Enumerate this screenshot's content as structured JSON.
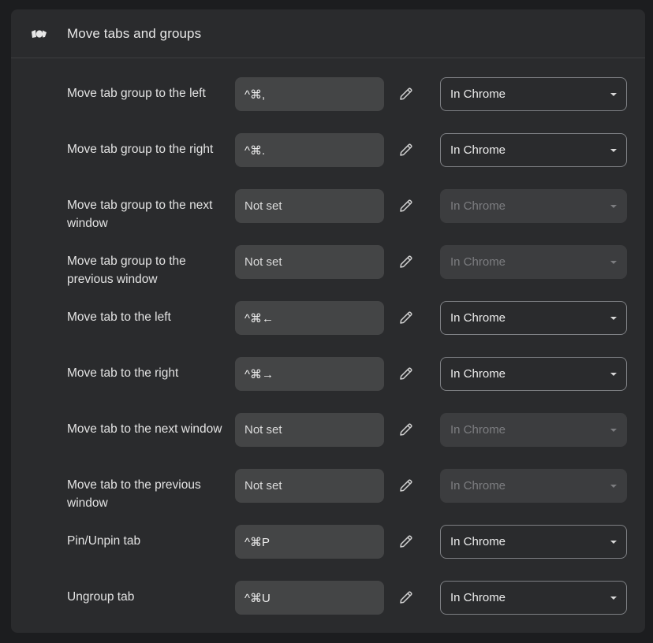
{
  "section": {
    "icon": "tabs-move-icon",
    "title": "Move tabs and groups"
  },
  "rows": [
    {
      "label": "Move tab group to the left",
      "shortcut": "^⌘,",
      "scope": "In Chrome",
      "scope_enabled": true
    },
    {
      "label": "Move tab group to the right",
      "shortcut": "^⌘.",
      "scope": "In Chrome",
      "scope_enabled": true
    },
    {
      "label": "Move tab group to the next window",
      "shortcut": "Not set",
      "scope": "In Chrome",
      "scope_enabled": false
    },
    {
      "label": "Move tab group to the previous window",
      "shortcut": "Not set",
      "scope": "In Chrome",
      "scope_enabled": false
    },
    {
      "label": "Move tab to the left",
      "shortcut": "^⌘←",
      "scope": "In Chrome",
      "scope_enabled": true
    },
    {
      "label": "Move tab to the right",
      "shortcut": "^⌘→",
      "scope": "In Chrome",
      "scope_enabled": true
    },
    {
      "label": "Move tab to the next window",
      "shortcut": "Not set",
      "scope": "In Chrome",
      "scope_enabled": false
    },
    {
      "label": "Move tab to the previous window",
      "shortcut": "Not set",
      "scope": "In Chrome",
      "scope_enabled": false
    },
    {
      "label": "Pin/Unpin tab",
      "shortcut": "^⌘P",
      "scope": "In Chrome",
      "scope_enabled": true
    },
    {
      "label": "Ungroup tab",
      "shortcut": "^⌘U",
      "scope": "In Chrome",
      "scope_enabled": true
    }
  ],
  "icons": {
    "edit": "pencil-icon",
    "dropdown": "caret-down-icon"
  }
}
